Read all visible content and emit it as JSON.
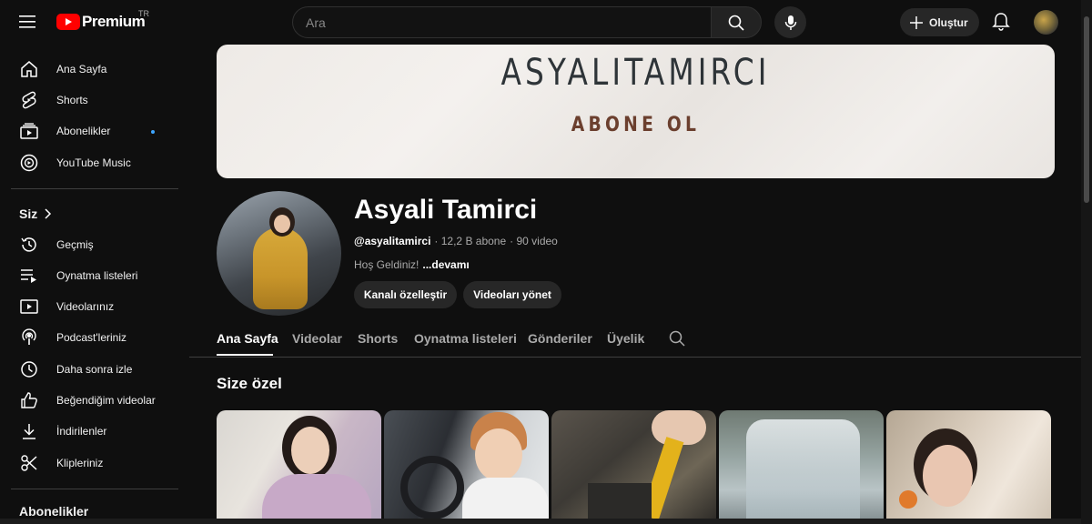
{
  "header": {
    "brand": "Premium",
    "country": "TR",
    "search_placeholder": "Ara",
    "create_label": "Oluştur"
  },
  "sidebar": {
    "main_items": [
      {
        "label": "Ana Sayfa",
        "icon": "home-icon"
      },
      {
        "label": "Shorts",
        "icon": "shorts-icon"
      },
      {
        "label": "Abonelikler",
        "icon": "subscriptions-icon"
      },
      {
        "label": "YouTube Music",
        "icon": "youtube-music-icon"
      }
    ],
    "you_title": "Siz",
    "you_items": [
      {
        "label": "Geçmiş",
        "icon": "history-icon"
      },
      {
        "label": "Oynatma listeleri",
        "icon": "playlists-icon"
      },
      {
        "label": "Videolarınız",
        "icon": "your-videos-icon"
      },
      {
        "label": "Podcast'leriniz",
        "icon": "podcast-icon"
      },
      {
        "label": "Daha sonra izle",
        "icon": "watch-later-icon"
      },
      {
        "label": "Beğendiğim videolar",
        "icon": "liked-icon"
      },
      {
        "label": "İndirilenler",
        "icon": "download-icon"
      },
      {
        "label": "Klipleriniz",
        "icon": "clips-icon"
      }
    ],
    "subs_title": "Abonelikler",
    "accent_dot_color": "#3ea6ff"
  },
  "banner": {
    "title": "ASYALITAMIRCI",
    "subtitle": "ABONE OL"
  },
  "channel": {
    "name": "Asyali Tamirci",
    "handle": "@asyalitamirci",
    "subscribers": "· 12,2 B abone",
    "videos": "· 90 video",
    "description": "Hoş Geldiniz!",
    "more": "...devamı",
    "customize_button": "Kanalı özelleştir",
    "manage_button": "Videoları yönet"
  },
  "tabs": [
    {
      "label": "Ana Sayfa",
      "active": true
    },
    {
      "label": "Videolar",
      "active": false
    },
    {
      "label": "Shorts",
      "active": false
    },
    {
      "label": "Oynatma listeleri",
      "active": false
    },
    {
      "label": "Gönderiler",
      "active": false
    },
    {
      "label": "Üyelik",
      "active": false
    }
  ],
  "section_title": "Size özel",
  "colors": {
    "background": "#0f0f0f",
    "brand_red": "#ff0000",
    "banner_subtitle": "#6b3f2e"
  }
}
